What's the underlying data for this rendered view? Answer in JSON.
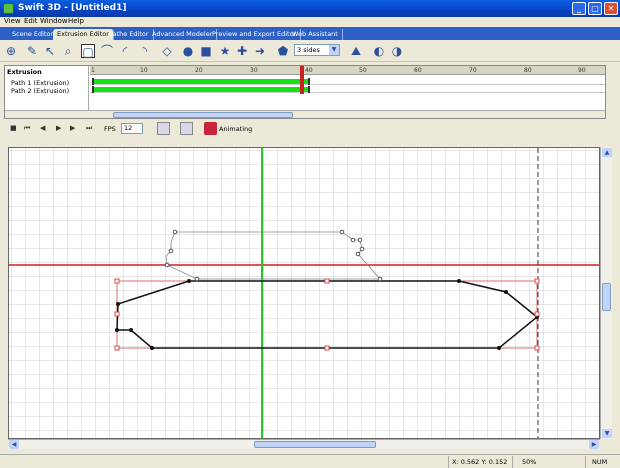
{
  "window": {
    "title": "Swift 3D - [Untitled1]",
    "minimize": "_",
    "maximize": "□",
    "close": "✕",
    "icon": "swift3d-logo-icon"
  },
  "menu": [
    "View",
    "Edit",
    "Window",
    "Help"
  ],
  "tabs": [
    "Scene Editor",
    "Extrusion Editor",
    "Lathe Editor",
    "Advanced Modeler",
    "Preview and Export Editor",
    "Web Assistant"
  ],
  "toolbar": {
    "sides_select": "3 sides"
  },
  "timeline": {
    "header": "Extrusion",
    "rows": [
      "Path 1 (Extrusion)",
      "Path 2 (Extrusion)"
    ],
    "ticks": [
      "1",
      "10",
      "20",
      "30",
      "40",
      "50",
      "60",
      "70",
      "80",
      "90"
    ]
  },
  "transport": {
    "fps_label": "FPS",
    "fps_value": "12",
    "animating_label": "Animating"
  },
  "status": {
    "coords": "X: 0.562  Y: 0.152",
    "zoom": "50%",
    "num": "NUM"
  },
  "colors": {
    "title_bar": "#0a5fe0",
    "tab_bar": "#2c60c7",
    "keyframe_bar": "#17e214",
    "axis_h": "#cc1f1f",
    "axis_v": "#22cc22"
  }
}
